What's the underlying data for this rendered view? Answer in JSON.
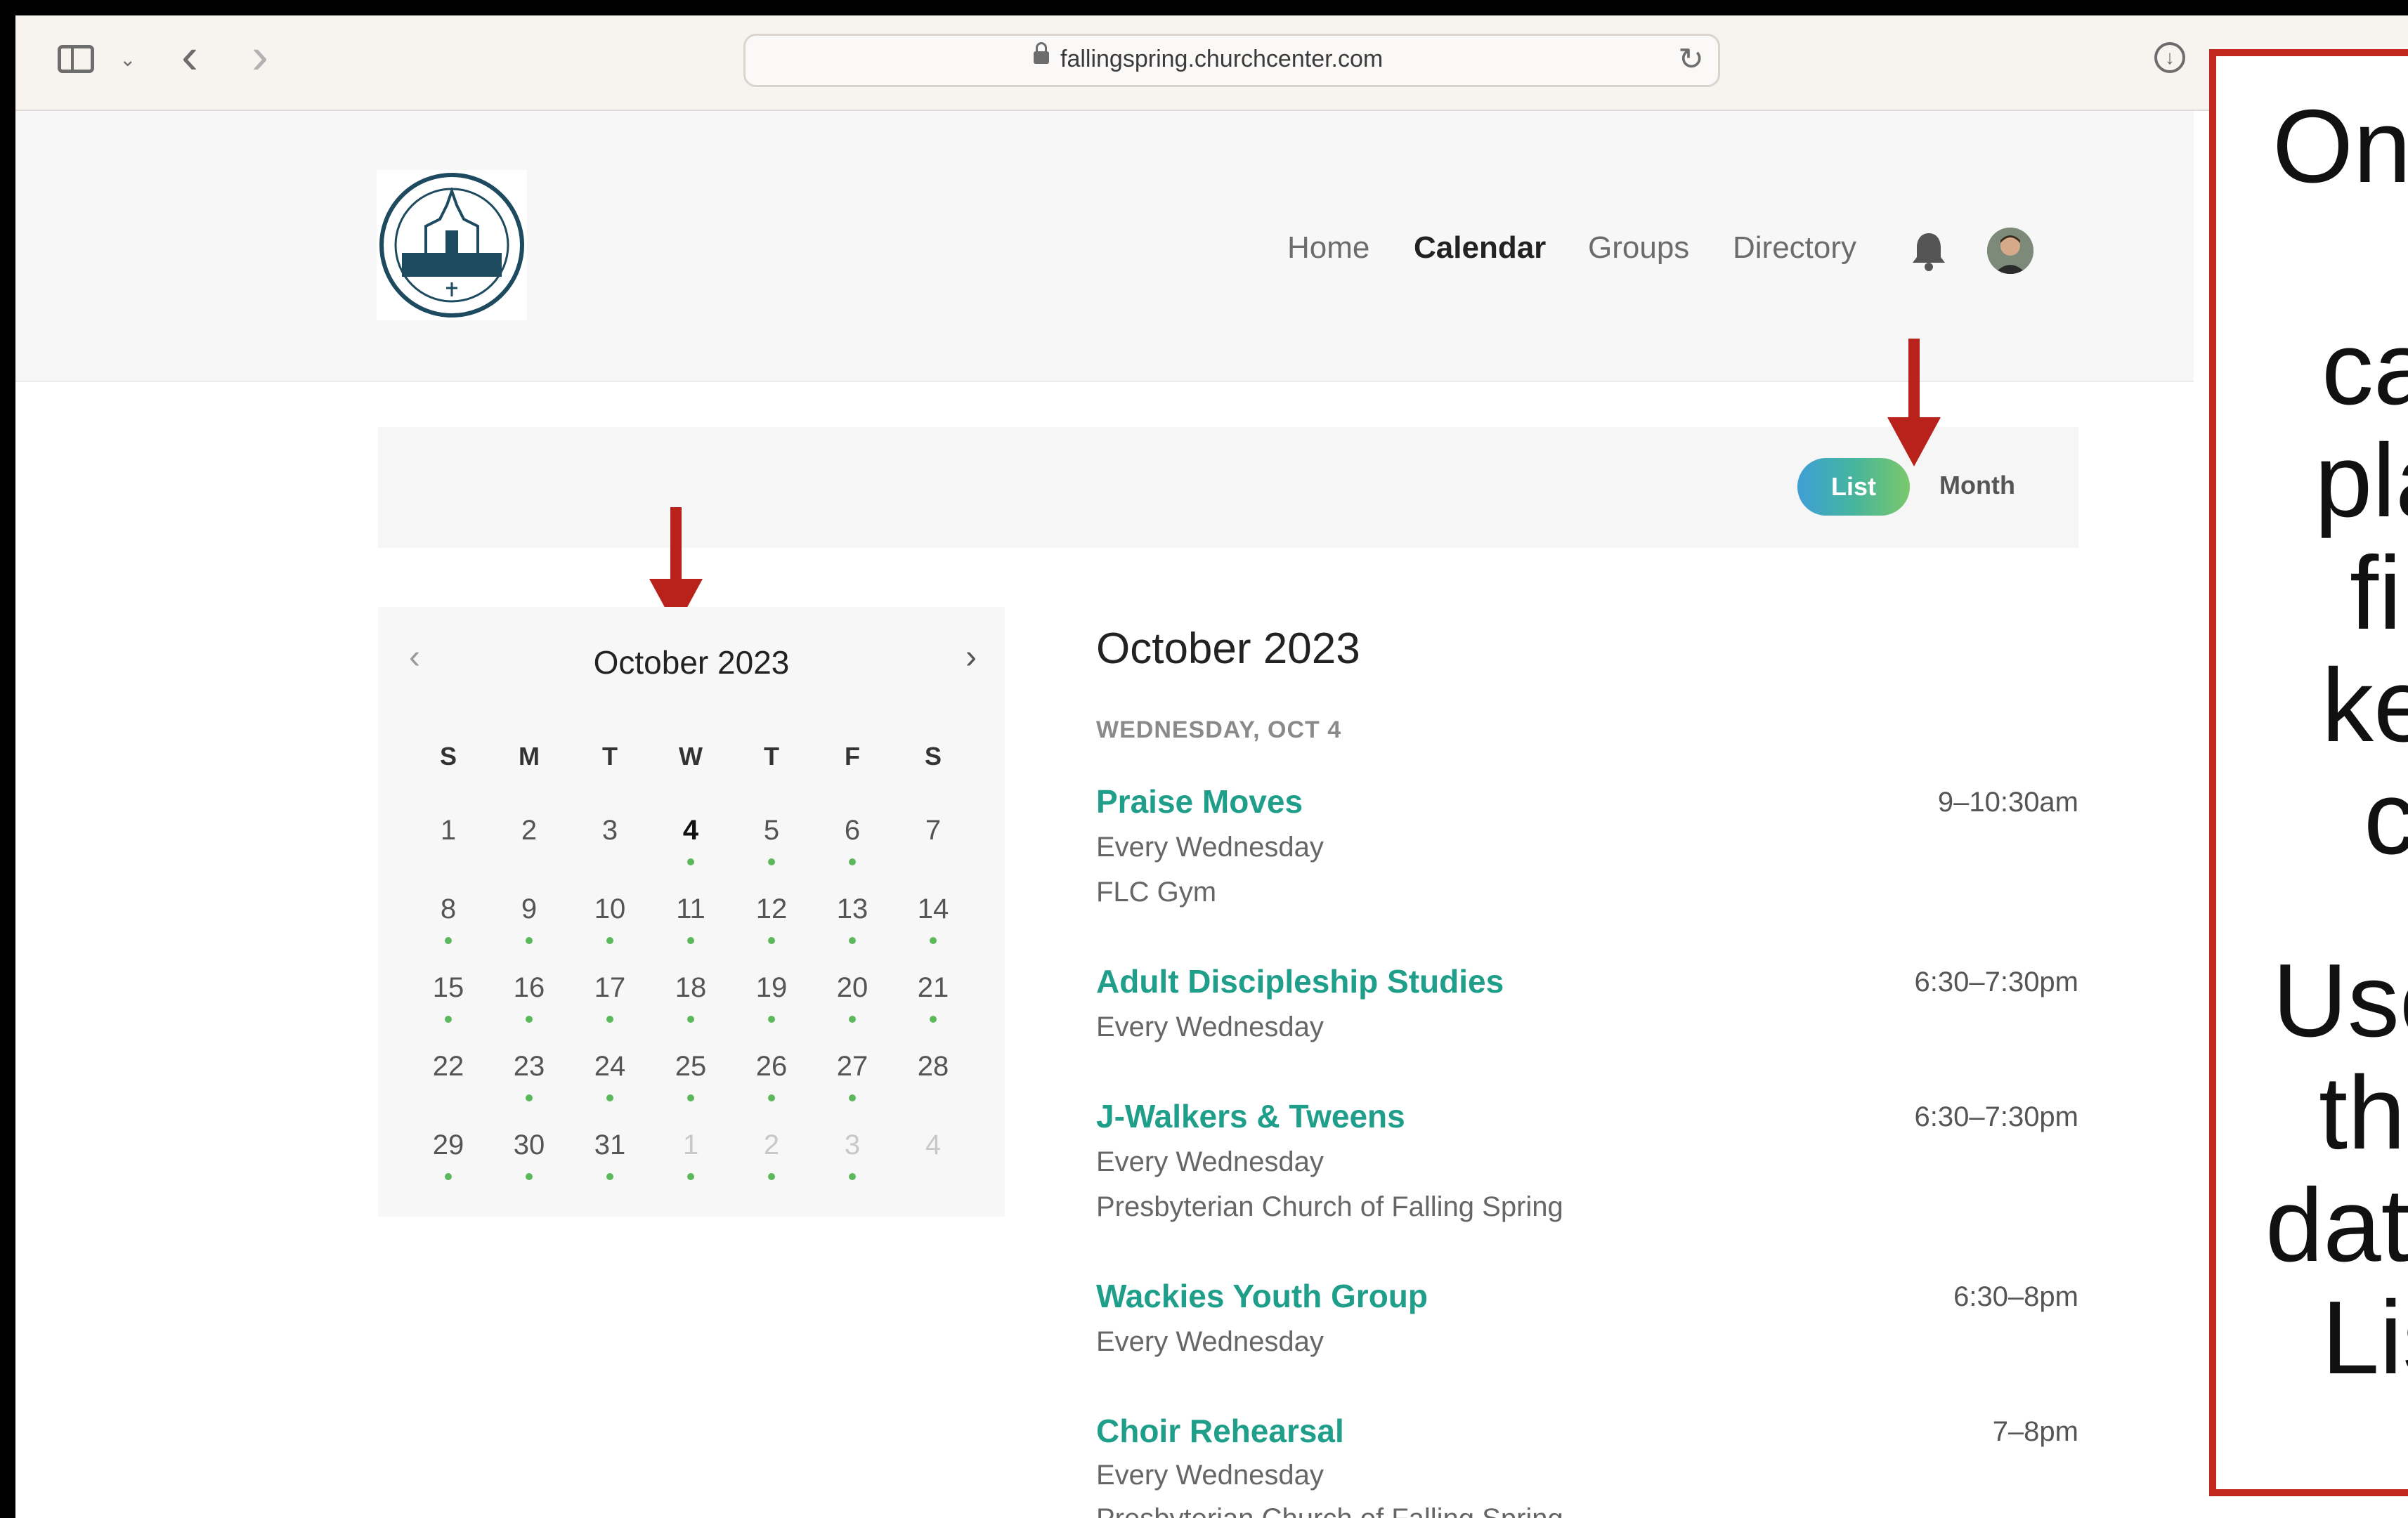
{
  "browser": {
    "url": "fallingspring.churchcenter.com"
  },
  "site": {
    "logo_text": "THE PRESBYTERIAN CHURCH OF FALLING SPRING",
    "nav": [
      "Home",
      "Calendar",
      "Groups",
      "Directory"
    ],
    "active_nav": "Calendar"
  },
  "view_toggle": {
    "list_label": "List",
    "month_label": "Month",
    "selected": "List"
  },
  "mini_calendar": {
    "title": "October 2023",
    "weekdays": [
      "S",
      "M",
      "T",
      "W",
      "T",
      "F",
      "S"
    ],
    "weeks": [
      [
        "1",
        "2",
        "3",
        "4",
        "5",
        "6",
        "7"
      ],
      [
        "8",
        "9",
        "10",
        "11",
        "12",
        "13",
        "14"
      ],
      [
        "15",
        "16",
        "17",
        "18",
        "19",
        "20",
        "21"
      ],
      [
        "22",
        "23",
        "24",
        "25",
        "26",
        "27",
        "28"
      ],
      [
        "29",
        "30",
        "31",
        "1",
        "2",
        "3",
        "4"
      ]
    ],
    "today": "4"
  },
  "event_list": {
    "title": "October 2023",
    "day_header": "WEDNESDAY, OCT 4",
    "events": [
      {
        "name": "Praise Moves",
        "recurrence": "Every Wednesday",
        "location": "FLC Gym",
        "time": "9–10:30am"
      },
      {
        "name": "Adult Discipleship Studies",
        "recurrence": "Every Wednesday",
        "location": "",
        "time": "6:30–7:30pm"
      },
      {
        "name": "J-Walkers & Tweens",
        "recurrence": "Every Wednesday",
        "location": "Presbyterian Church of Falling Spring",
        "time": "6:30–7:30pm"
      },
      {
        "name": "Wackies Youth Group",
        "recurrence": "Every Wednesday",
        "location": "",
        "time": "6:30–8pm"
      },
      {
        "name": "Choir Rehearsal",
        "recurrence": "Every Wednesday",
        "location": "Presbyterian Church of Falling Spring",
        "time": "7–8pm"
      }
    ]
  },
  "callout": {
    "lines": [
      "On",
      "ca",
      "pla",
      "fi",
      "ke",
      "c",
      "Use",
      "th",
      "dat",
      "Lis"
    ]
  },
  "colors": {
    "accent": "#1f9e8a",
    "arrow": "#b8221a",
    "callout_border": "#c1271d",
    "event_dot": "#5cb85c"
  }
}
